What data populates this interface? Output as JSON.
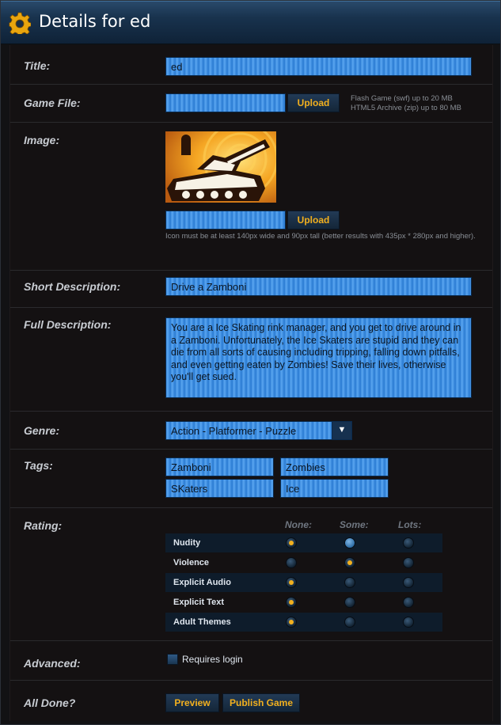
{
  "header": {
    "title": "Details for ed"
  },
  "labels": {
    "title": "Title:",
    "game_file": "Game File:",
    "image": "Image:",
    "short_description": "Short Description:",
    "full_description": "Full Description:",
    "genre": "Genre:",
    "tags": "Tags:",
    "rating": "Rating:",
    "advanced": "Advanced:",
    "all_done": "All Done?"
  },
  "fields": {
    "title": "ed",
    "short_description": "Drive a Zamboni",
    "full_description": "You are a Ice Skating rink manager, and you get to drive around in a Zamboni. Unfortunately, the Ice Skaters are stupid and they can die from all sorts of causing including tripping, falling down pitfalls, and even getting eaten by Zombies! Save their lives, otherwise you'll get sued.",
    "genre": "Action - Platformer - Puzzle",
    "game_file": "",
    "image_file": ""
  },
  "buttons": {
    "upload": "Upload",
    "preview": "Preview",
    "publish": "Publish Game"
  },
  "hints": {
    "game_file_line1": "Flash Game (swf) up to 20 MB",
    "game_file_line2": "HTML5 Archive (zip) up to 80 MB",
    "image": "Icon must be at least 140px wide and 90px tall (better results with 435px * 280px and higher)."
  },
  "tags": [
    "Zamboni",
    "Zombies",
    "SKaters",
    "Ice"
  ],
  "rating": {
    "columns": [
      "None:",
      "Some:",
      "Lots:"
    ],
    "rows": [
      {
        "label": "Nudity",
        "selected": 0
      },
      {
        "label": "Violence",
        "selected": 1
      },
      {
        "label": "Explicit Audio",
        "selected": 0
      },
      {
        "label": "Explicit Text",
        "selected": 0
      },
      {
        "label": "Adult Themes",
        "selected": 0
      }
    ]
  },
  "advanced": {
    "requires_login": "Requires login",
    "requires_login_checked": false
  },
  "colors": {
    "accent": "#f2b01e",
    "field_blue": "#3f8fe0",
    "header_blue": "#18324d"
  }
}
